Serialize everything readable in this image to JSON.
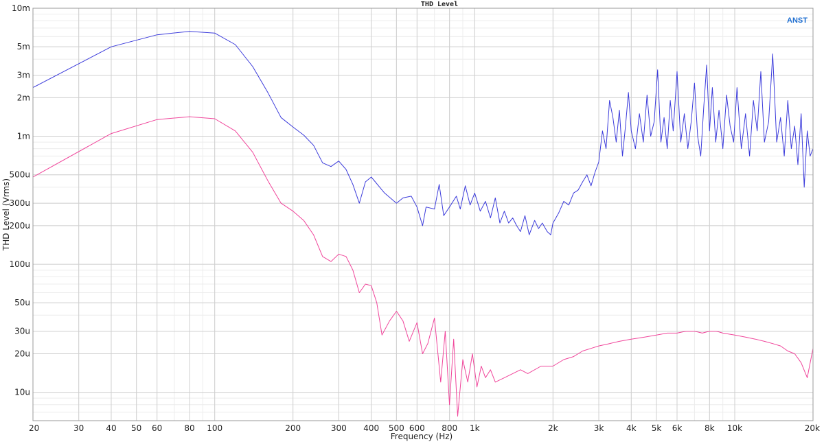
{
  "chart_data": {
    "type": "line",
    "title": "THD Level",
    "xlabel": "Frequency (Hz)",
    "ylabel": "THD Level (Vrms)",
    "brand": "ANST",
    "brand_color": "#1f6fd1",
    "x_scale": "log",
    "y_scale": "log",
    "xlim": [
      20,
      20000
    ],
    "ylim": [
      6e-06,
      0.01
    ],
    "grid": true,
    "x_ticks": [
      {
        "value": 20,
        "label": "20"
      },
      {
        "value": 30,
        "label": "30"
      },
      {
        "value": 40,
        "label": "40"
      },
      {
        "value": 50,
        "label": "50"
      },
      {
        "value": 60,
        "label": "60"
      },
      {
        "value": 80,
        "label": "80"
      },
      {
        "value": 100,
        "label": "100"
      },
      {
        "value": 200,
        "label": "200"
      },
      {
        "value": 300,
        "label": "300"
      },
      {
        "value": 400,
        "label": "400"
      },
      {
        "value": 500,
        "label": "500"
      },
      {
        "value": 600,
        "label": "600"
      },
      {
        "value": 800,
        "label": "800"
      },
      {
        "value": 1000,
        "label": "1k"
      },
      {
        "value": 2000,
        "label": "2k"
      },
      {
        "value": 3000,
        "label": "3k"
      },
      {
        "value": 4000,
        "label": "4k"
      },
      {
        "value": 5000,
        "label": "5k"
      },
      {
        "value": 6000,
        "label": "6k"
      },
      {
        "value": 8000,
        "label": "8k"
      },
      {
        "value": 10000,
        "label": "10k"
      },
      {
        "value": 20000,
        "label": "20k"
      }
    ],
    "y_ticks": [
      {
        "value": 1e-05,
        "label": "10u"
      },
      {
        "value": 2e-05,
        "label": "20u"
      },
      {
        "value": 3e-05,
        "label": "30u"
      },
      {
        "value": 5e-05,
        "label": "50u"
      },
      {
        "value": 0.0001,
        "label": "100u"
      },
      {
        "value": 0.0002,
        "label": "200u"
      },
      {
        "value": 0.0003,
        "label": "300u"
      },
      {
        "value": 0.0005,
        "label": "500u"
      },
      {
        "value": 0.001,
        "label": "1m"
      },
      {
        "value": 0.002,
        "label": "2m"
      },
      {
        "value": 0.003,
        "label": "3m"
      },
      {
        "value": 0.005,
        "label": "5m"
      },
      {
        "value": 0.01,
        "label": "10m"
      }
    ],
    "series": [
      {
        "color": "#3b3bdb",
        "points": [
          [
            20,
            0.0024
          ],
          [
            40,
            0.005
          ],
          [
            60,
            0.0062
          ],
          [
            80,
            0.0066
          ],
          [
            100,
            0.0064
          ],
          [
            120,
            0.0052
          ],
          [
            140,
            0.0035
          ],
          [
            160,
            0.0022
          ],
          [
            180,
            0.0014
          ],
          [
            200,
            0.00118
          ],
          [
            220,
            0.00102
          ],
          [
            240,
            0.00085
          ],
          [
            260,
            0.00062
          ],
          [
            280,
            0.00058
          ],
          [
            300,
            0.00064
          ],
          [
            320,
            0.00055
          ],
          [
            340,
            0.00042
          ],
          [
            360,
            0.0003
          ],
          [
            380,
            0.00044
          ],
          [
            400,
            0.00048
          ],
          [
            450,
            0.00036
          ],
          [
            500,
            0.0003
          ],
          [
            530,
            0.00033
          ],
          [
            570,
            0.00034
          ],
          [
            600,
            0.00028
          ],
          [
            630,
            0.0002
          ],
          [
            650,
            0.00028
          ],
          [
            700,
            0.00027
          ],
          [
            730,
            0.00042
          ],
          [
            760,
            0.00024
          ],
          [
            800,
            0.00028
          ],
          [
            850,
            0.00034
          ],
          [
            880,
            0.00027
          ],
          [
            920,
            0.00041
          ],
          [
            960,
            0.00029
          ],
          [
            1000,
            0.00036
          ],
          [
            1050,
            0.00026
          ],
          [
            1100,
            0.00031
          ],
          [
            1150,
            0.00023
          ],
          [
            1200,
            0.00033
          ],
          [
            1250,
            0.00021
          ],
          [
            1300,
            0.00026
          ],
          [
            1350,
            0.00021
          ],
          [
            1400,
            0.00023
          ],
          [
            1450,
            0.0002
          ],
          [
            1500,
            0.00018
          ],
          [
            1560,
            0.00024
          ],
          [
            1620,
            0.00017
          ],
          [
            1700,
            0.00022
          ],
          [
            1760,
            0.00019
          ],
          [
            1820,
            0.00021
          ],
          [
            1900,
            0.00018
          ],
          [
            1960,
            0.00017
          ],
          [
            2000,
            0.00021
          ],
          [
            2100,
            0.00025
          ],
          [
            2200,
            0.00031
          ],
          [
            2300,
            0.00029
          ],
          [
            2400,
            0.00036
          ],
          [
            2500,
            0.00038
          ],
          [
            2600,
            0.00044
          ],
          [
            2700,
            0.0005
          ],
          [
            2800,
            0.00041
          ],
          [
            2900,
            0.00052
          ],
          [
            3000,
            0.00063
          ],
          [
            3100,
            0.0011
          ],
          [
            3200,
            0.0008
          ],
          [
            3300,
            0.0019
          ],
          [
            3400,
            0.0014
          ],
          [
            3500,
            0.0009
          ],
          [
            3600,
            0.0016
          ],
          [
            3700,
            0.0007
          ],
          [
            3800,
            0.0012
          ],
          [
            3900,
            0.0022
          ],
          [
            4000,
            0.0011
          ],
          [
            4150,
            0.0008
          ],
          [
            4300,
            0.0015
          ],
          [
            4450,
            0.0009
          ],
          [
            4600,
            0.0021
          ],
          [
            4750,
            0.001
          ],
          [
            4900,
            0.0013
          ],
          [
            5050,
            0.0033
          ],
          [
            5200,
            0.0009
          ],
          [
            5350,
            0.0014
          ],
          [
            5500,
            0.0008
          ],
          [
            5650,
            0.0019
          ],
          [
            5800,
            0.0011
          ],
          [
            6000,
            0.0032
          ],
          [
            6200,
            0.0009
          ],
          [
            6400,
            0.0015
          ],
          [
            6600,
            0.0008
          ],
          [
            6800,
            0.0013
          ],
          [
            7000,
            0.0026
          ],
          [
            7200,
            0.001
          ],
          [
            7400,
            0.0007
          ],
          [
            7600,
            0.0017
          ],
          [
            7800,
            0.0036
          ],
          [
            8000,
            0.0011
          ],
          [
            8200,
            0.0024
          ],
          [
            8450,
            0.0009
          ],
          [
            8700,
            0.0016
          ],
          [
            9000,
            0.0008
          ],
          [
            9300,
            0.0021
          ],
          [
            9600,
            0.0012
          ],
          [
            9900,
            0.0009
          ],
          [
            10200,
            0.0024
          ],
          [
            10600,
            0.0008
          ],
          [
            11000,
            0.0015
          ],
          [
            11400,
            0.0007
          ],
          [
            11800,
            0.0019
          ],
          [
            12200,
            0.0011
          ],
          [
            12600,
            0.0032
          ],
          [
            13000,
            0.0009
          ],
          [
            13500,
            0.0013
          ],
          [
            14000,
            0.0044
          ],
          [
            14500,
            0.0009
          ],
          [
            15000,
            0.0014
          ],
          [
            15500,
            0.0007
          ],
          [
            16000,
            0.0019
          ],
          [
            16500,
            0.0008
          ],
          [
            17000,
            0.0012
          ],
          [
            17500,
            0.0006
          ],
          [
            18000,
            0.0015
          ],
          [
            18500,
            0.0004
          ],
          [
            19000,
            0.0011
          ],
          [
            19500,
            0.0007
          ],
          [
            20000,
            0.0008
          ]
        ]
      },
      {
        "color": "#f0449a",
        "points": [
          [
            20,
            0.00048
          ],
          [
            40,
            0.00105
          ],
          [
            60,
            0.00135
          ],
          [
            80,
            0.00142
          ],
          [
            100,
            0.00137
          ],
          [
            120,
            0.0011
          ],
          [
            140,
            0.00075
          ],
          [
            160,
            0.00045
          ],
          [
            180,
            0.0003
          ],
          [
            200,
            0.00026
          ],
          [
            220,
            0.00022
          ],
          [
            240,
            0.00017
          ],
          [
            260,
            0.000115
          ],
          [
            280,
            0.000105
          ],
          [
            300,
            0.00012
          ],
          [
            320,
            0.000115
          ],
          [
            340,
            9e-05
          ],
          [
            360,
            6e-05
          ],
          [
            380,
            7e-05
          ],
          [
            400,
            6.8e-05
          ],
          [
            420,
            5e-05
          ],
          [
            440,
            2.8e-05
          ],
          [
            470,
            3.6e-05
          ],
          [
            500,
            4.3e-05
          ],
          [
            530,
            3.6e-05
          ],
          [
            560,
            2.5e-05
          ],
          [
            600,
            3.5e-05
          ],
          [
            630,
            2e-05
          ],
          [
            660,
            2.4e-05
          ],
          [
            700,
            3.8e-05
          ],
          [
            740,
            1.2e-05
          ],
          [
            770,
            3e-05
          ],
          [
            800,
            8e-06
          ],
          [
            830,
            2.6e-05
          ],
          [
            860,
            6.5e-06
          ],
          [
            900,
            1.8e-05
          ],
          [
            940,
            1.2e-05
          ],
          [
            980,
            2e-05
          ],
          [
            1020,
            1.1e-05
          ],
          [
            1060,
            1.6e-05
          ],
          [
            1100,
            1.3e-05
          ],
          [
            1150,
            1.5e-05
          ],
          [
            1200,
            1.2e-05
          ],
          [
            1300,
            1.3e-05
          ],
          [
            1400,
            1.4e-05
          ],
          [
            1500,
            1.5e-05
          ],
          [
            1600,
            1.4e-05
          ],
          [
            1800,
            1.6e-05
          ],
          [
            2000,
            1.6e-05
          ],
          [
            2200,
            1.8e-05
          ],
          [
            2400,
            1.9e-05
          ],
          [
            2600,
            2.1e-05
          ],
          [
            2800,
            2.2e-05
          ],
          [
            3000,
            2.3e-05
          ],
          [
            3300,
            2.4e-05
          ],
          [
            3600,
            2.5e-05
          ],
          [
            4000,
            2.6e-05
          ],
          [
            4500,
            2.7e-05
          ],
          [
            5000,
            2.8e-05
          ],
          [
            5500,
            2.9e-05
          ],
          [
            6000,
            2.9e-05
          ],
          [
            6500,
            3e-05
          ],
          [
            7000,
            3e-05
          ],
          [
            7500,
            2.9e-05
          ],
          [
            8000,
            3e-05
          ],
          [
            8500,
            3e-05
          ],
          [
            9000,
            2.9e-05
          ],
          [
            10000,
            2.8e-05
          ],
          [
            11000,
            2.7e-05
          ],
          [
            12000,
            2.6e-05
          ],
          [
            13000,
            2.5e-05
          ],
          [
            14000,
            2.4e-05
          ],
          [
            15000,
            2.3e-05
          ],
          [
            16000,
            2.1e-05
          ],
          [
            17000,
            2e-05
          ],
          [
            18000,
            1.7e-05
          ],
          [
            19000,
            1.3e-05
          ],
          [
            20000,
            2.2e-05
          ]
        ]
      }
    ]
  }
}
